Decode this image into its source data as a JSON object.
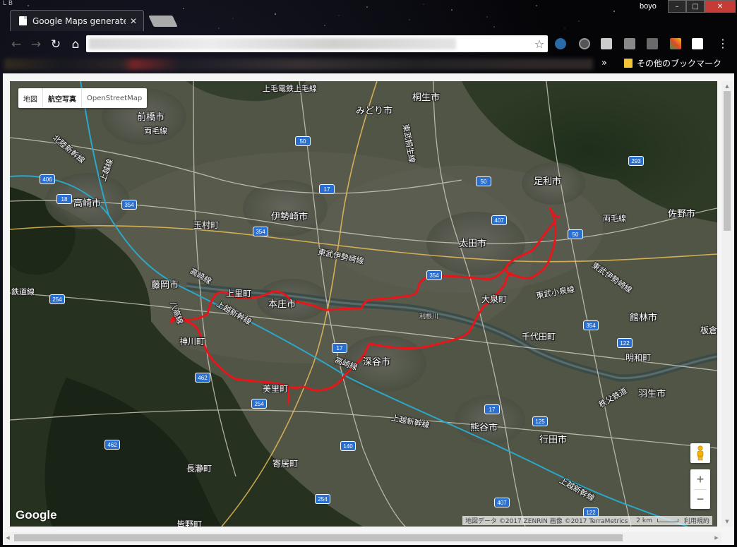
{
  "tab": {
    "title": "Google Maps generate",
    "close_icon": "close-icon"
  },
  "window": {
    "profile": "boyo",
    "minimize": "–",
    "maximize": "□",
    "close": "✕",
    "corner_mark": "L B"
  },
  "toolbar": {
    "back": "←",
    "forward": "→",
    "reload": "↻",
    "home": "⌂",
    "bookmark_star": "☆",
    "menu": "⋮"
  },
  "bookmarks": {
    "chevron": "»",
    "other_label": "その他のブックマーク"
  },
  "map": {
    "type_controls": [
      "地図",
      "航空写真",
      "OpenStreetMap"
    ],
    "active_type": "航空写真",
    "zoom_in": "+",
    "zoom_out": "−",
    "logo": "Google",
    "attribution": "地図データ ©2017 ZENRIN 画像 ©2017 TerraMetrics",
    "scale": "2 km",
    "terms": "利用規約",
    "route_color": "#e8151b",
    "places": [
      "前橋市",
      "高崎市",
      "伊勢崎市",
      "太田市",
      "足利市",
      "佐野市",
      "桐生市",
      "みどり市",
      "藤岡市",
      "本庄市",
      "深谷市",
      "熊谷市",
      "行田市",
      "館林市",
      "羽生市",
      "千代田町",
      "明和町",
      "大泉町",
      "玉村町",
      "上里町",
      "神川町",
      "美里町",
      "寄居町",
      "長瀞町",
      "皆野町",
      "板倉"
    ],
    "lines": [
      "上毛電鉄上毛線",
      "両毛線",
      "北陸新幹線",
      "上越線",
      "東武桐生線",
      "東武伊勢崎線",
      "八高線",
      "上越新幹線",
      "高崎線",
      "東武小泉線",
      "秩父鉄道",
      "鉄道線",
      "利根川"
    ],
    "routes": [
      "406",
      "18",
      "354",
      "50",
      "17",
      "407",
      "293",
      "254",
      "462",
      "140",
      "125",
      "122"
    ]
  }
}
